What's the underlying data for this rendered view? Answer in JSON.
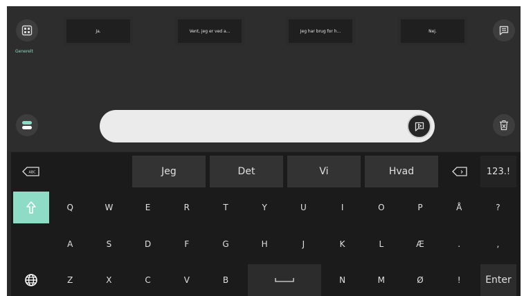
{
  "top_bar": {
    "category_label": "Generelt",
    "phrases": [
      "Ja.",
      "Vent, jeg er ved a...",
      "Jeg har brug for h...",
      "Nej."
    ]
  },
  "input": {
    "value": ""
  },
  "suggestions": [
    "Jeg",
    "Det",
    "Vi",
    "Hvad"
  ],
  "keyboard": {
    "row1": [
      "Q",
      "W",
      "E",
      "R",
      "T",
      "Y",
      "U",
      "I",
      "O",
      "P",
      "Å",
      "?"
    ],
    "row2": [
      "A",
      "S",
      "D",
      "F",
      "G",
      "H",
      "J",
      "K",
      "L",
      "Æ",
      ".",
      ","
    ],
    "row3_left": [
      "Z",
      "X",
      "C",
      "V",
      "B"
    ],
    "row3_right": [
      "N",
      "M",
      "Ø",
      "!"
    ],
    "numbers_label": "123.!",
    "enter_label": "Enter",
    "abc_label": "ABC"
  },
  "colors": {
    "accent": "#8edcc5",
    "background": "#2a2a2a",
    "input": "#ebebeb"
  }
}
